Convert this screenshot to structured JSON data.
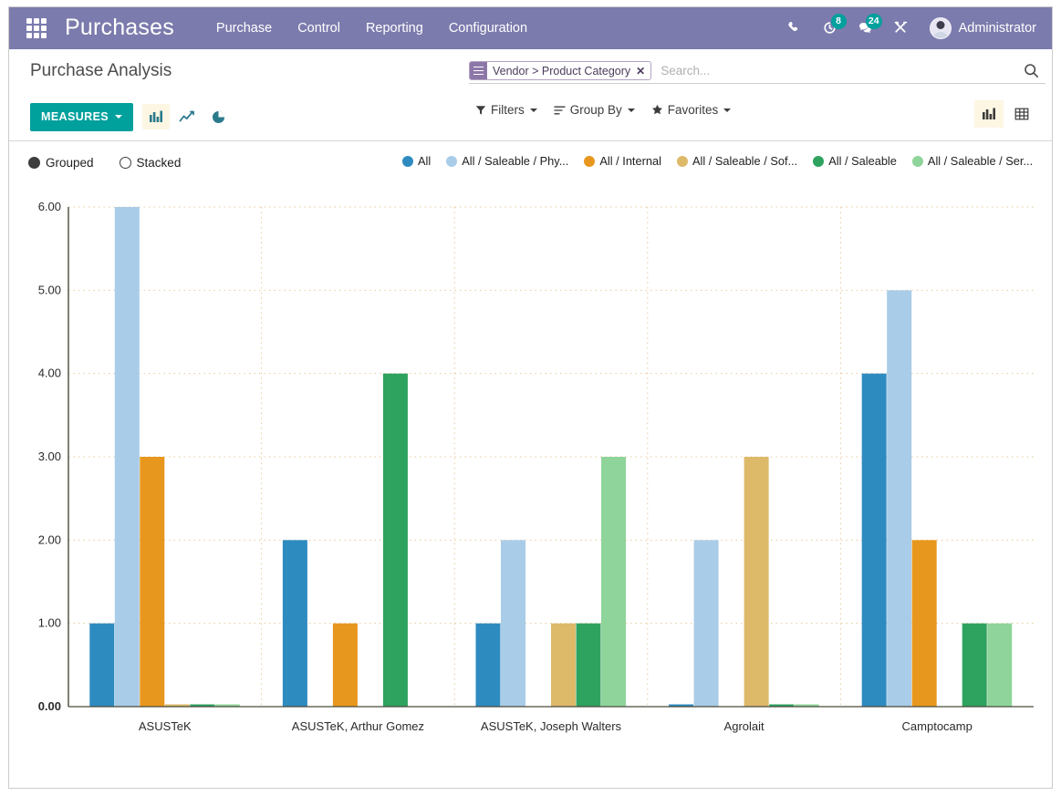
{
  "navbar": {
    "apps_icon": "apps-grid-icon",
    "brand": "Purchases",
    "menu": [
      {
        "label": "Purchase"
      },
      {
        "label": "Control"
      },
      {
        "label": "Reporting"
      },
      {
        "label": "Configuration"
      }
    ],
    "icons": [
      {
        "name": "phone-icon",
        "badge": null
      },
      {
        "name": "activity-clock-icon",
        "badge": "8"
      },
      {
        "name": "messages-icon",
        "badge": "24"
      },
      {
        "name": "tools-icon",
        "badge": null
      }
    ],
    "user": "Administrator",
    "brand_color": "#7C7BAD",
    "badge_color": "#00A09D"
  },
  "control_panel": {
    "title": "Purchase Analysis",
    "measures_label": "MEASURES",
    "measures_color": "#00A09D",
    "chart_type_buttons": [
      {
        "name": "bar-chart-icon",
        "active": true
      },
      {
        "name": "line-chart-icon",
        "active": false
      },
      {
        "name": "pie-chart-icon",
        "active": false
      }
    ],
    "search": {
      "facet_label": "Vendor > Product Category",
      "facet_close": "✕",
      "placeholder": "Search...",
      "value": ""
    },
    "dropdowns": [
      {
        "label": "Filters",
        "icon": "filter-icon"
      },
      {
        "label": "Group By",
        "icon": "group-by-icon"
      },
      {
        "label": "Favorites",
        "icon": "star-icon"
      }
    ],
    "view_switcher": [
      {
        "name": "graph-view-icon",
        "active": true
      },
      {
        "name": "pivot-view-icon",
        "active": false
      }
    ]
  },
  "chart_controls": {
    "modes": [
      {
        "label": "Grouped",
        "selected": true
      },
      {
        "label": "Stacked",
        "selected": false
      }
    ]
  },
  "chart_data": {
    "type": "bar",
    "title": "",
    "xlabel": "",
    "ylabel": "",
    "ylim": [
      0,
      6
    ],
    "yticks": [
      "0.00",
      "1.00",
      "2.00",
      "3.00",
      "4.00",
      "5.00",
      "6.00"
    ],
    "grid": true,
    "legend_position": "top",
    "stacked": false,
    "categories": [
      "ASUSTeK",
      "ASUSTeK, Arthur Gomez",
      "ASUSTeK, Joseph Walters",
      "Agrolait",
      "Camptocamp"
    ],
    "series": [
      {
        "name": "All",
        "color": "#2E8BC0",
        "values": [
          1,
          2,
          1,
          0.02,
          4
        ]
      },
      {
        "name": "All / Saleable / Phy...",
        "color": "#A9CCE8",
        "values": [
          6,
          0,
          2,
          2,
          5
        ]
      },
      {
        "name": "All / Internal",
        "color": "#E8971E",
        "values": [
          3,
          1,
          0,
          0,
          2
        ]
      },
      {
        "name": "All / Saleable / Sof...",
        "color": "#DDB96A",
        "values": [
          0.02,
          0,
          1,
          3,
          0
        ]
      },
      {
        "name": "All / Saleable",
        "color": "#2EA25F",
        "values": [
          0.02,
          4,
          1,
          0.02,
          1
        ]
      },
      {
        "name": "All / Saleable / Ser...",
        "color": "#8FD49A",
        "values": [
          0.02,
          0,
          3,
          0.02,
          1
        ]
      }
    ]
  }
}
